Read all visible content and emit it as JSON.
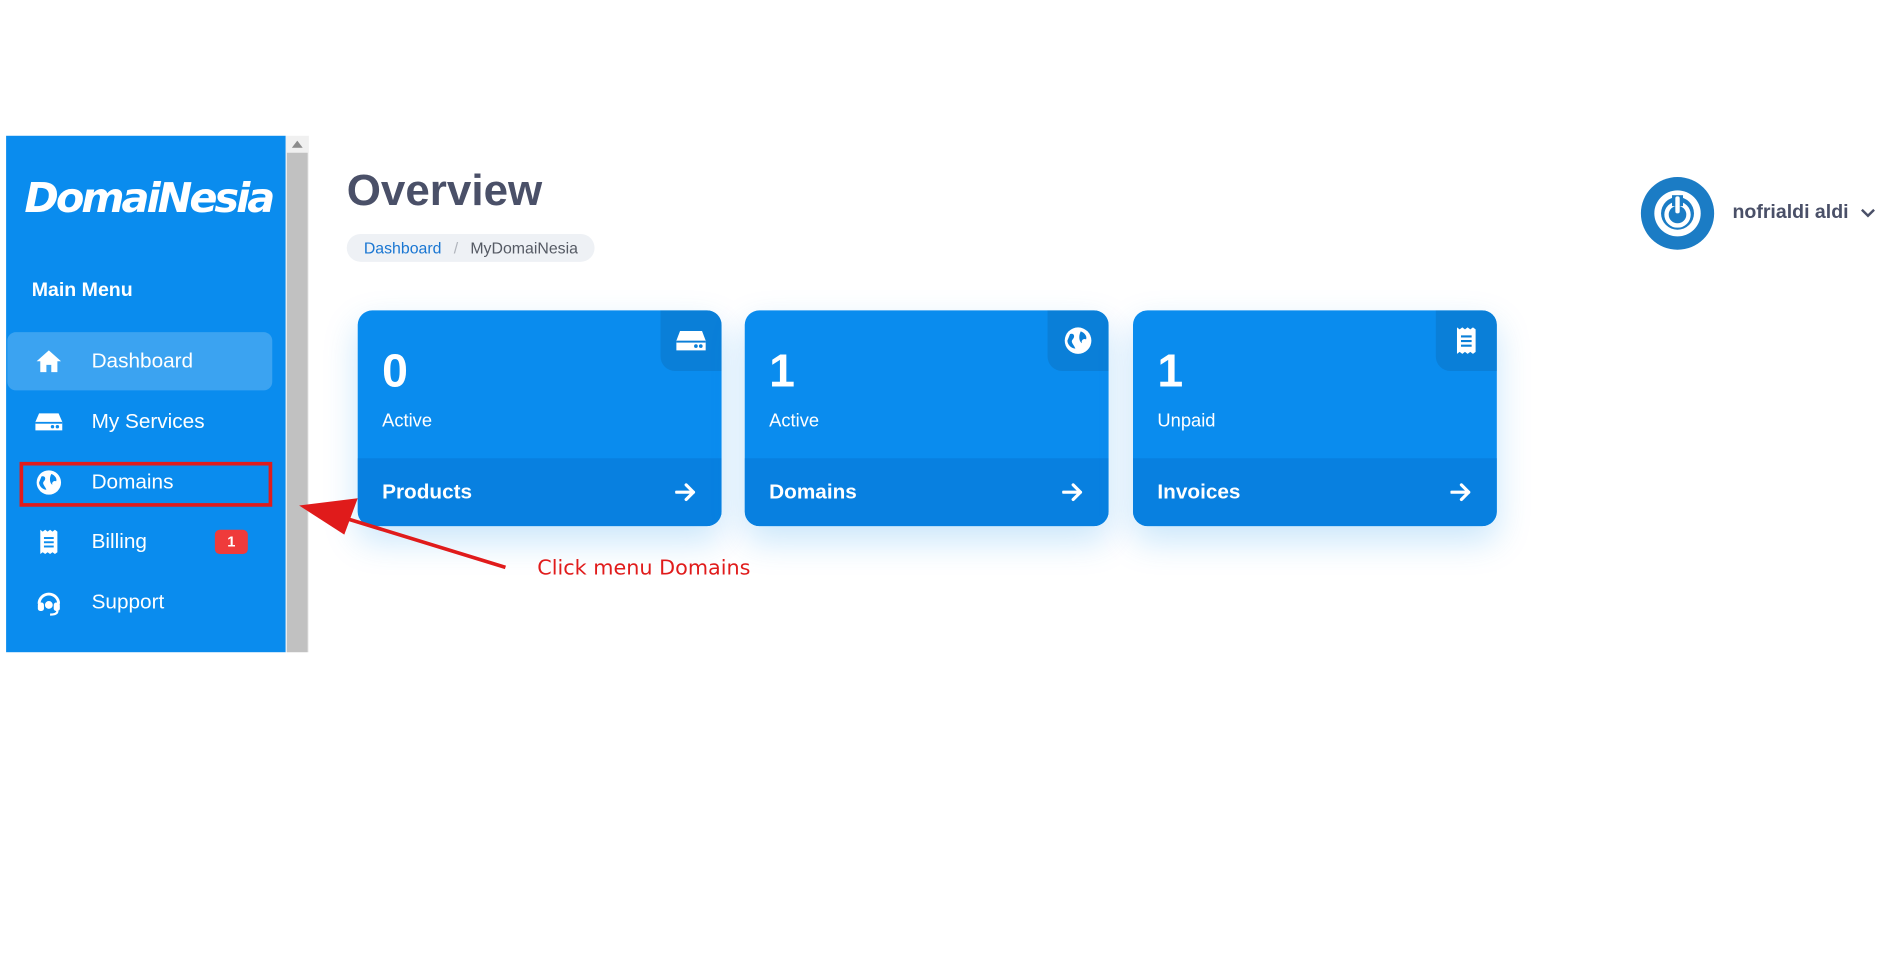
{
  "brand": {
    "logo_text": "DomaiNesia"
  },
  "sidebar": {
    "section_title": "Main Menu",
    "items": [
      {
        "label": "Dashboard",
        "icon": "home-icon",
        "active": true
      },
      {
        "label": "My Services",
        "icon": "server-icon"
      },
      {
        "label": "Domains",
        "icon": "globe-icon"
      },
      {
        "label": "Billing",
        "icon": "receipt-icon",
        "badge": "1"
      },
      {
        "label": "Support",
        "icon": "headset-icon"
      }
    ]
  },
  "header": {
    "title": "Overview",
    "breadcrumb": {
      "link": "Dashboard",
      "separator": "/",
      "current": "MyDomaiNesia"
    },
    "user": {
      "name": "nofrialdi aldi",
      "avatar_icon": "power-icon",
      "dropdown_icon": "chevron-down-icon"
    }
  },
  "cards": [
    {
      "count": "0",
      "status": "Active",
      "label": "Products",
      "icon": "server-icon"
    },
    {
      "count": "1",
      "status": "Active",
      "label": "Domains",
      "icon": "globe-icon"
    },
    {
      "count": "1",
      "status": "Unpaid",
      "label": "Invoices",
      "icon": "receipt-icon"
    }
  ],
  "annotation": {
    "text": "Click menu Domains"
  },
  "colors": {
    "primary": "#0a8cee",
    "card_footer": "#0880e0",
    "title_text": "#4a5068",
    "annotation": "#e01b1b",
    "badge": "#ef3b3b"
  }
}
